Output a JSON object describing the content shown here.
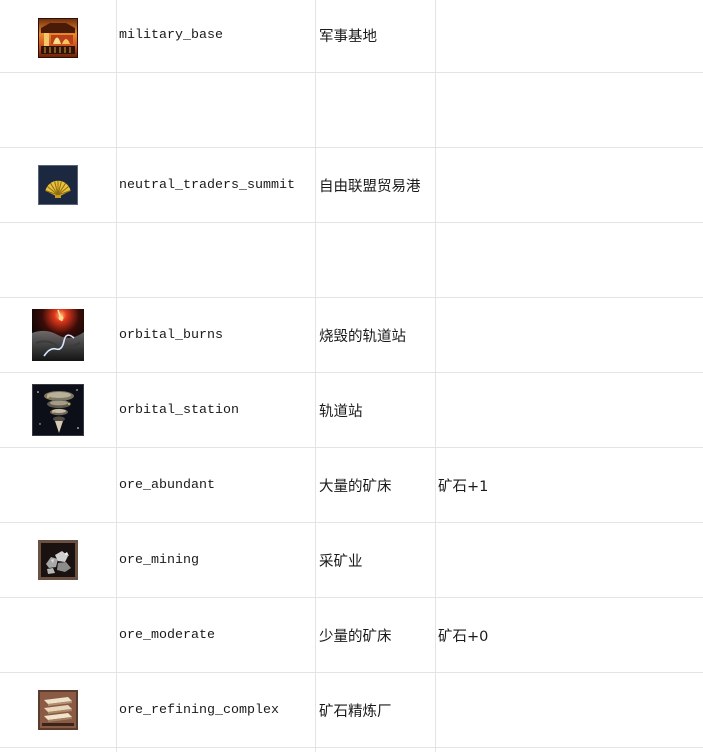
{
  "rows": [
    {
      "icon": "military-base-icon",
      "id": "military_base",
      "name": "军事基地"
    },
    {},
    {
      "icon": "shell-icon",
      "id": "neutral_traders_summit",
      "name": "自由联盟贸易港"
    },
    {},
    {
      "icon": "orbital-burns-icon",
      "id": "orbital_burns",
      "name": "烧毁的轨道站"
    },
    {
      "icon": "orbital-station-icon",
      "id": "orbital_station",
      "name": "轨道站"
    },
    {
      "id": "ore_abundant",
      "name": "大量的矿床",
      "effect": "矿石+1"
    },
    {
      "icon": "ore-mining-icon",
      "id": "ore_mining",
      "name": "采矿业"
    },
    {
      "id": "ore_moderate",
      "name": "少量的矿床",
      "effect": "矿石+0"
    },
    {
      "icon": "ore-refining-icon",
      "id": "ore_refining_complex",
      "name": "矿石精炼厂"
    }
  ],
  "colors": {
    "grid": "#e4e4e4",
    "text": "#1a1a1a",
    "background": "#ffffff"
  }
}
